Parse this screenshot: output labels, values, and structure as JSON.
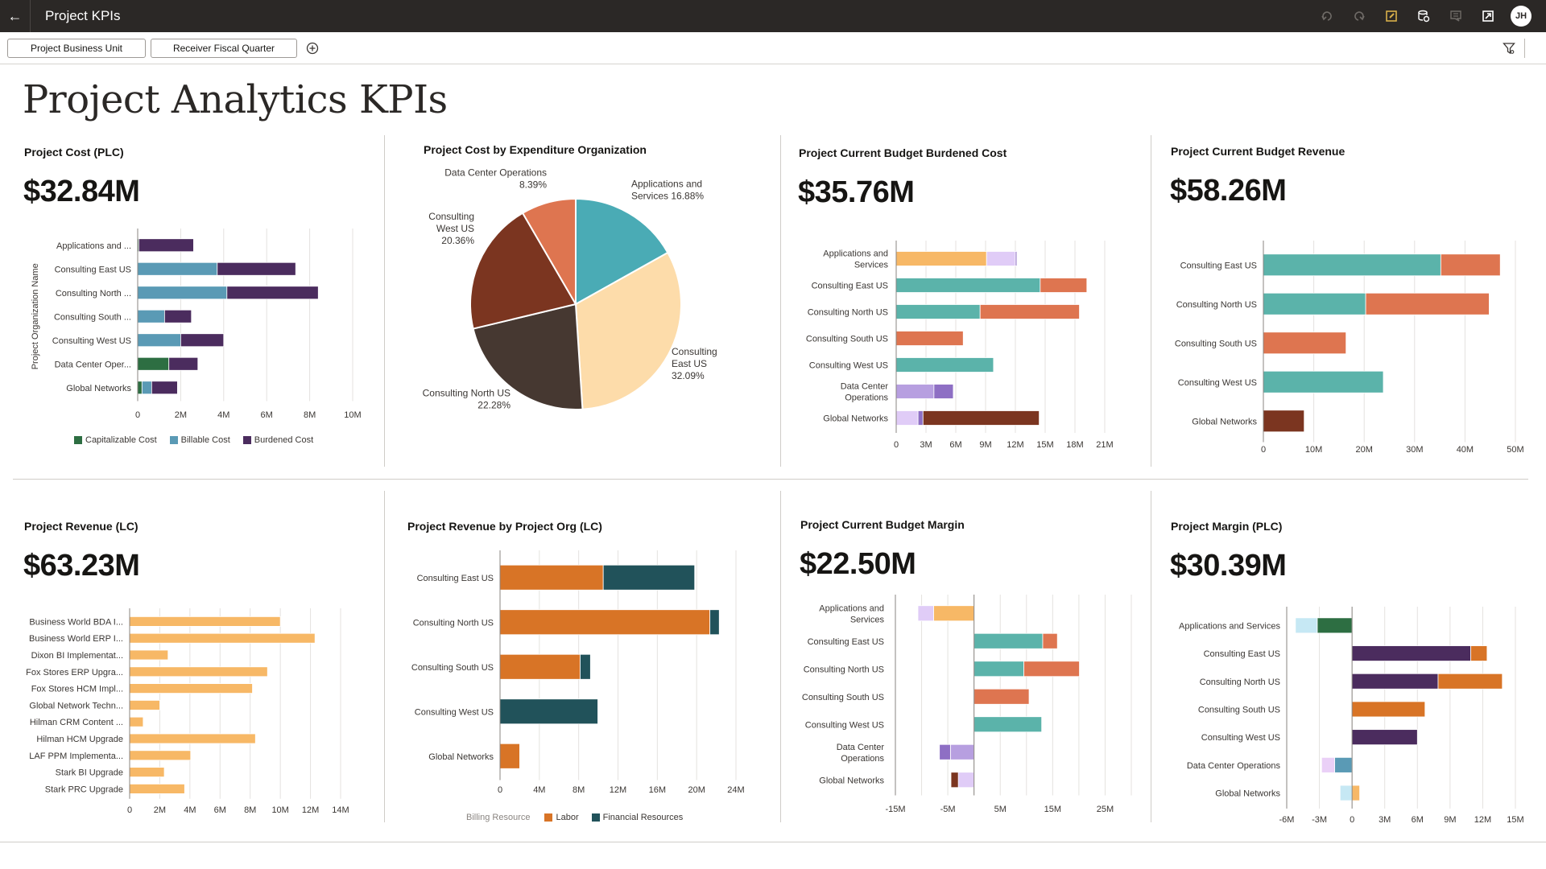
{
  "app": {
    "title": "Project KPIs",
    "back_icon": "arrow-left-icon",
    "toolbar_icons": [
      "undo-icon",
      "redo-icon",
      "edit-icon",
      "data-refresh-icon",
      "comment-icon",
      "export-icon"
    ],
    "user_initials": "JH"
  },
  "filters": {
    "items": [
      "Project Business Unit",
      "Receiver Fiscal Quarter"
    ],
    "add_icon": "add-circle-icon",
    "filter_icon": "filter-settings-icon"
  },
  "page": {
    "title": "Project Analytics KPIs"
  },
  "colors": {
    "capitalizable": "#2d6e42",
    "billable": "#5a9ab5",
    "burdened": "#4b2c5e",
    "teal": "#5bb3aa",
    "coral": "#de7550",
    "amber": "#f7b866",
    "lilac": "#e0ccf7",
    "lavender": "#b79fe0",
    "purple": "#8e6fc4",
    "rust": "#7b3520",
    "orange": "#d87426",
    "dark_teal": "#21525a",
    "light_blue": "#c6e8f4",
    "green": "#2d6e42",
    "plum": "#4b2c5e",
    "steel": "#5a9ab5",
    "pink_lilac": "#ead0f7",
    "light_amber": "#f7b866"
  },
  "tiles": {
    "project_cost": {
      "title": "Project Cost (PLC)",
      "kpi": "$32.84M"
    },
    "cost_by_org": {
      "title": "Project Cost by Expenditure Organization"
    },
    "budget_burdened": {
      "title": "Project Current Budget Burdened Cost",
      "kpi": "$35.76M"
    },
    "budget_revenue": {
      "title": "Project Current Budget Revenue",
      "kpi": "$58.26M"
    },
    "project_revenue": {
      "title": "Project Revenue (LC)",
      "kpi": "$63.23M"
    },
    "revenue_by_org": {
      "title": "Project Revenue by Project Org (LC)"
    },
    "budget_margin": {
      "title": "Project Current Budget Margin",
      "kpi": "$22.50M"
    },
    "project_margin": {
      "title": "Project Margin (PLC)",
      "kpi": "$30.39M"
    }
  },
  "chart_data": [
    {
      "id": "project_cost",
      "type": "bar",
      "orientation": "horizontal",
      "stacked": true,
      "ylabel": "Project Organization Name",
      "categories": [
        "Applications and ...",
        "Consulting East US",
        "Consulting North ...",
        "Consulting South ...",
        "Consulting West US",
        "Data Center Oper...",
        "Global Networks"
      ],
      "series": [
        {
          "name": "Capitalizable Cost",
          "color": "#2d6e42",
          "values": [
            0.05,
            0,
            0,
            0,
            0,
            1.45,
            0.2
          ]
        },
        {
          "name": "Billable Cost",
          "color": "#5a9ab5",
          "values": [
            0,
            3.7,
            4.15,
            1.25,
            2.0,
            0,
            0.45
          ]
        },
        {
          "name": "Burdened Cost",
          "color": "#4b2c5e",
          "values": [
            2.55,
            3.65,
            4.25,
            1.25,
            2.0,
            1.35,
            1.2
          ]
        }
      ],
      "xlim": [
        0,
        10
      ],
      "xticks": [
        0,
        2,
        4,
        6,
        8,
        10
      ],
      "xtick_labels": [
        "0",
        "2M",
        "4M",
        "6M",
        "8M",
        "10M"
      ],
      "units": "M",
      "legend": "bottom",
      "grid": true
    },
    {
      "id": "cost_by_org",
      "type": "pie",
      "title": "Project Cost by Expenditure Organization",
      "slices": [
        {
          "label": "Applications and Services",
          "value": 16.88,
          "color": "#4aabb5",
          "label_lines": [
            "Applications and",
            "Services 16.88%"
          ]
        },
        {
          "label": "Consulting East US",
          "value": 32.09,
          "color": "#fddcaa",
          "label_lines": [
            "Consulting",
            "East US",
            "32.09%"
          ]
        },
        {
          "label": "Consulting North US",
          "value": 22.28,
          "color": "#463831",
          "label_lines": [
            "Consulting North US",
            "22.28%"
          ]
        },
        {
          "label": "Consulting West US",
          "value": 20.36,
          "color": "#7b3520",
          "label_lines": [
            "Consulting",
            "West US",
            "20.36%"
          ]
        },
        {
          "label": "Data Center Operations",
          "value": 8.39,
          "color": "#de7550",
          "label_lines": [
            "Data Center Operations",
            "8.39%"
          ]
        }
      ],
      "units": "%"
    },
    {
      "id": "budget_burdened",
      "type": "bar",
      "orientation": "horizontal",
      "stacked": true,
      "categories": [
        [
          "Applications and",
          "Services"
        ],
        [
          "Consulting East US"
        ],
        [
          "Consulting North US"
        ],
        [
          "Consulting South US"
        ],
        [
          "Consulting West US"
        ],
        [
          "Data Center",
          "Operations"
        ],
        [
          "Global Networks"
        ]
      ],
      "segments": [
        [
          [
            "#f7b866",
            9.1
          ],
          [
            "#e0ccf7",
            2.9
          ],
          [
            "#8e6fc4",
            0.15
          ]
        ],
        [
          [
            "#5bb3aa",
            14.5
          ],
          [
            "#de7550",
            4.7
          ]
        ],
        [
          [
            "#5bb3aa",
            8.45
          ],
          [
            "#de7550",
            10.0
          ]
        ],
        [
          [
            "#de7550",
            6.75
          ]
        ],
        [
          [
            "#5bb3aa",
            9.8
          ]
        ],
        [
          [
            "#b79fe0",
            3.8
          ],
          [
            "#8e6fc4",
            1.95
          ]
        ],
        [
          [
            "#e0ccf7",
            2.2
          ],
          [
            "#8e6fc4",
            0.5
          ],
          [
            "#7b3520",
            11.7
          ]
        ]
      ],
      "xlim": [
        0,
        21
      ],
      "xticks": [
        0,
        3,
        6,
        9,
        12,
        15,
        18,
        21
      ],
      "xtick_labels": [
        "0",
        "3M",
        "6M",
        "9M",
        "12M",
        "15M",
        "18M",
        "21M"
      ],
      "units": "M",
      "grid": true
    },
    {
      "id": "budget_revenue",
      "type": "bar",
      "orientation": "horizontal",
      "stacked": true,
      "categories": [
        [
          "Consulting East US"
        ],
        [
          "Consulting North US"
        ],
        [
          "Consulting South US"
        ],
        [
          "Consulting West US"
        ],
        [
          "Global Networks"
        ]
      ],
      "segments": [
        [
          [
            "#5bb3aa",
            35.2
          ],
          [
            "#de7550",
            11.8
          ]
        ],
        [
          [
            "#5bb3aa",
            20.3
          ],
          [
            "#de7550",
            24.5
          ]
        ],
        [
          [
            "#de7550",
            16.4
          ]
        ],
        [
          [
            "#5bb3aa",
            23.8
          ]
        ],
        [
          [
            "#7b3520",
            8.1
          ]
        ]
      ],
      "xlim": [
        0,
        50
      ],
      "xticks": [
        0,
        10,
        20,
        30,
        40,
        50
      ],
      "xtick_labels": [
        "0",
        "10M",
        "20M",
        "30M",
        "40M",
        "50M"
      ],
      "units": "M",
      "grid": true
    },
    {
      "id": "project_revenue",
      "type": "bar",
      "orientation": "horizontal",
      "categories": [
        "Business World BDA I...",
        "Business World ERP I...",
        "Dixon BI Implementat...",
        "Fox Stores ERP Upgra...",
        "Fox Stores HCM Impl...",
        "Global Network Techn...",
        "Hilman CRM Content ...",
        "Hilman HCM Upgrade",
        "LAF PPM Implementa...",
        "Stark BI Upgrade",
        "Stark PRC Upgrade"
      ],
      "values": [
        10.0,
        12.3,
        2.55,
        9.15,
        8.15,
        2.0,
        0.9,
        8.35,
        4.05,
        2.3,
        3.65
      ],
      "color": "#f7b866",
      "xlim": [
        0,
        14
      ],
      "xticks": [
        0,
        2,
        4,
        6,
        8,
        10,
        12,
        14
      ],
      "xtick_labels": [
        "0",
        "2M",
        "4M",
        "6M",
        "8M",
        "10M",
        "12M",
        "14M"
      ],
      "units": "M",
      "grid": true
    },
    {
      "id": "revenue_by_org",
      "type": "bar",
      "orientation": "horizontal",
      "stacked": true,
      "categories": [
        "Consulting East US",
        "Consulting North US",
        "Consulting South US",
        "Consulting West US",
        "Global Networks"
      ],
      "series": [
        {
          "name": "Labor",
          "color": "#d87426",
          "values": [
            10.5,
            21.35,
            8.15,
            0,
            2.0
          ]
        },
        {
          "name": "Financial Resources",
          "color": "#21525a",
          "values": [
            9.3,
            0.95,
            1.05,
            9.95,
            0
          ]
        }
      ],
      "legend_title": "Billing Resource",
      "xlim": [
        0,
        24
      ],
      "xticks": [
        0,
        4,
        8,
        12,
        16,
        20,
        24
      ],
      "xtick_labels": [
        "0",
        "4M",
        "8M",
        "12M",
        "16M",
        "20M",
        "24M"
      ],
      "units": "M",
      "legend": "bottom",
      "grid": true
    },
    {
      "id": "budget_margin",
      "type": "bar",
      "orientation": "horizontal",
      "stacked": true,
      "diverging": true,
      "categories": [
        [
          "Applications and",
          "Services"
        ],
        [
          "Consulting East US"
        ],
        [
          "Consulting North US"
        ],
        [
          "Consulting South US"
        ],
        [
          "Consulting West US"
        ],
        [
          "Data Center",
          "Operations"
        ],
        [
          "Global Networks"
        ]
      ],
      "segments": [
        [
          [
            "#f7b866",
            -7.7
          ],
          [
            "#e0ccf7",
            -3.0
          ]
        ],
        [
          [
            "#5bb3aa",
            13.1
          ],
          [
            "#de7550",
            2.8
          ]
        ],
        [
          [
            "#5bb3aa",
            9.5
          ],
          [
            "#de7550",
            10.6
          ]
        ],
        [
          [
            "#de7550",
            10.5
          ]
        ],
        [
          [
            "#5bb3aa",
            12.9
          ]
        ],
        [
          [
            "#b79fe0",
            -4.5
          ],
          [
            "#8e6fc4",
            -2.1
          ]
        ],
        [
          [
            "#e0ccf7",
            -3.0
          ],
          [
            "#7b3520",
            -1.4
          ]
        ]
      ],
      "xlim": [
        -15,
        30
      ],
      "xticks": [
        -15,
        -10,
        -5,
        0,
        5,
        10,
        15,
        20,
        25,
        30
      ],
      "xtick_labels": [
        "-15M",
        "-5M",
        "5M",
        "15M",
        "25M"
      ],
      "xtick_label_values": [
        -15,
        -5,
        5,
        15,
        25
      ],
      "units": "M",
      "grid": true
    },
    {
      "id": "project_margin",
      "type": "bar",
      "orientation": "horizontal",
      "stacked": true,
      "diverging": true,
      "categories": [
        [
          "Applications and Services"
        ],
        [
          "Consulting East US"
        ],
        [
          "Consulting North US"
        ],
        [
          "Consulting South US"
        ],
        [
          "Consulting West US"
        ],
        [
          "Data Center Operations"
        ],
        [
          "Global Networks"
        ]
      ],
      "segments": [
        [
          [
            "#2d6e42",
            -3.2
          ],
          [
            "#c6e8f4",
            -2.0
          ]
        ],
        [
          [
            "#4b2c5e",
            10.9
          ],
          [
            "#d87426",
            1.5
          ]
        ],
        [
          [
            "#4b2c5e",
            7.9
          ],
          [
            "#d87426",
            5.9
          ]
        ],
        [
          [
            "#d87426",
            6.7
          ]
        ],
        [
          [
            "#4b2c5e",
            6.0
          ]
        ],
        [
          [
            "#5a9ab5",
            -1.6
          ],
          [
            "#ead0f7",
            -1.2
          ]
        ],
        [
          [
            "#c6e8f4",
            -1.1
          ],
          [
            "#f7b866",
            0.7
          ]
        ]
      ],
      "xlim": [
        -6,
        15
      ],
      "xticks": [
        -6,
        -3,
        0,
        3,
        6,
        9,
        12,
        15
      ],
      "xtick_labels": [
        "-6M",
        "-3M",
        "0",
        "3M",
        "6M",
        "9M",
        "12M",
        "15M"
      ],
      "units": "M",
      "grid": true
    }
  ]
}
